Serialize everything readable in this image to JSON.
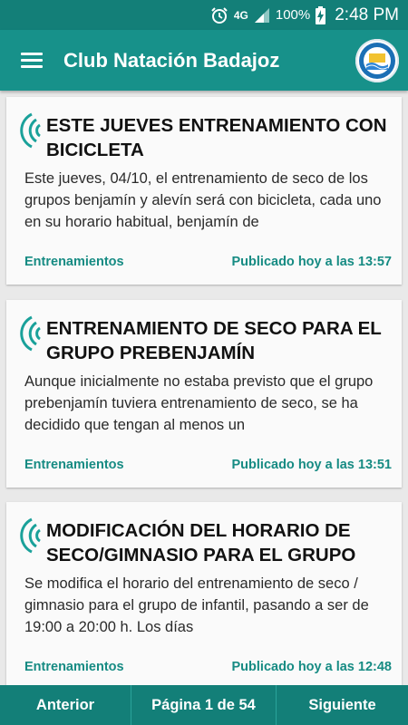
{
  "status_bar": {
    "network": "4G",
    "battery": "100%",
    "time": "2:48 PM",
    "icons": [
      "alarm-icon",
      "signal-icon",
      "battery-charging-icon"
    ]
  },
  "app_bar": {
    "title": "Club Natación Badajoz",
    "menu_icon": "hamburger-menu-icon",
    "logo_icon": "club-logo-icon"
  },
  "colors": {
    "primary": "#17918a",
    "primary_dark": "#137f78",
    "accent_text": "#168b83"
  },
  "posts": [
    {
      "title": "ESTE JUEVES ENTRENAMIENTO CON BICICLETA",
      "summary": "Este jueves, 04/10, el entrenamiento de seco de los grupos benjamín y alevín será con bicicleta, cada uno en su horario habitual, benjamín de",
      "category": "Entrenamientos",
      "published": "Publicado hoy a las 13:57"
    },
    {
      "title": "ENTRENAMIENTO DE SECO PARA EL GRUPO PREBENJAMÍN",
      "summary": "Aunque inicialmente no estaba previsto que el grupo prebenjamín tuviera entrenamiento de seco, se ha decidido que tengan al menos un",
      "category": "Entrenamientos",
      "published": "Publicado hoy a las 13:51"
    },
    {
      "title": "MODIFICACIÓN DEL HORARIO DE SECO/GIMNASIO PARA EL GRUPO",
      "summary": "Se modifica el horario del entrenamiento de seco / gimnasio para el grupo de infantil, pasando a ser de 19:00 a 20:00 h. Los días",
      "category": "Entrenamientos",
      "published": "Publicado hoy a las 12:48"
    }
  ],
  "pagination": {
    "previous_label": "Anterior",
    "page_label": "Página 1 de 54",
    "next_label": "Siguiente"
  }
}
